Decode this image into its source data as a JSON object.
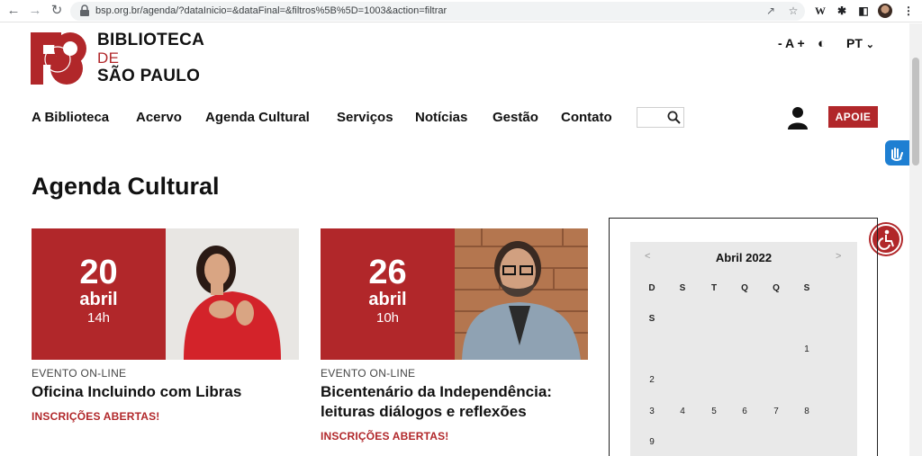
{
  "browser": {
    "url": "bsp.org.br/agenda/?dataInicio=&dataFinal=&filtros%5B%5D=1003&action=filtrar"
  },
  "site": {
    "logo_line1": "BIBLIOTECA",
    "logo_line2": "DE",
    "logo_line3": "SÃO PAULO",
    "font_control": "- A +",
    "contrast_icon": "◐",
    "language": "PT",
    "menu": [
      "A Biblioteca",
      "Acervo",
      "Agenda Cultural",
      "Serviços",
      "Notícias",
      "Gestão",
      "Contato"
    ],
    "apoie": "APOIE",
    "brand_color": "#b1272a"
  },
  "main": {
    "title": "Agenda Cultural",
    "cards": [
      {
        "day": "20",
        "month": "abril",
        "hour": "14h",
        "type": "EVENTO ON-LINE",
        "title": "Oficina Incluindo com Libras",
        "status": "INSCRIÇÕES ABERTAS!"
      },
      {
        "day": "26",
        "month": "abril",
        "hour": "10h",
        "type": "EVENTO ON-LINE",
        "title_line1": "Bicentenário da Independência:",
        "title_line2": "leituras diálogos e reflexões",
        "status": "INSCRIÇÕES ABERTAS!"
      }
    ]
  },
  "calendar": {
    "month": "Abril 2022",
    "prev": "<",
    "next": ">",
    "weekdays": [
      "D",
      "S",
      "T",
      "Q",
      "Q",
      "S",
      "S"
    ],
    "days": [
      "1",
      "2",
      "3",
      "4",
      "5",
      "6",
      "7",
      "8",
      "9"
    ]
  }
}
